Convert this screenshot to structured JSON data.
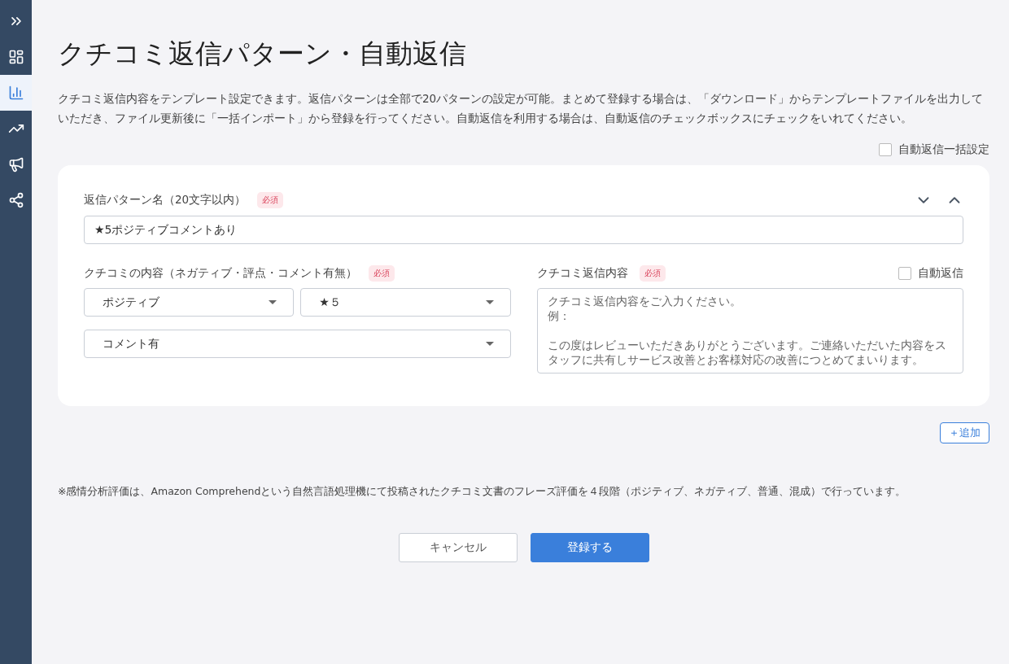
{
  "sidebar": {
    "items": [
      {
        "kind": "expand",
        "selected": false
      },
      {
        "kind": "dashboard",
        "selected": false
      },
      {
        "kind": "chart",
        "selected": true
      },
      {
        "kind": "trend",
        "selected": false
      },
      {
        "kind": "megaphone",
        "selected": false
      },
      {
        "kind": "share",
        "selected": false
      }
    ]
  },
  "title": "クチコミ返信パターン・自動返信",
  "description": "クチコミ返信内容をテンプレート設定できます。返信パターンは全部で20パターンの設定が可能。まとめて登録する場合は、「ダウンロード」からテンプレートファイルを出力していただき、ファイル更新後に「一括インポート」から登録を行ってください。自動返信を利用する場合は、自動返信のチェックボックスにチェックをいれてください。",
  "bulk_auto_reply": {
    "label": "自動返信一括設定",
    "checked": false
  },
  "pattern": {
    "name_label": "返信パターン名（20文字以内）",
    "name_required": "必須",
    "name_value": "★5ポジティブコメントあり",
    "content_label": "クチコミの内容（ネガティブ・評点・コメント有無）",
    "content_required": "必須",
    "selects": [
      "ポジティブ",
      "★５",
      "コメント有"
    ],
    "reply_label": "クチコミ返信内容",
    "reply_required": "必須",
    "auto_reply": {
      "label": "自動返信",
      "checked": false
    },
    "reply_placeholder": [
      "クチコミ返信内容をご入力ください。",
      "例：",
      "この度はレビューいただきありがとうございます。ご連絡いただいた内容をスタッフに共有しサービス改善とお客様対応の改善につとめてまいります。"
    ]
  },
  "add_button": "＋追加",
  "note": "※感情分析評価は、Amazon Comprehendという自然言語処理機にて投稿されたクチコミ文書のフレーズ評価を４段階（ポジティブ、ネガティブ、普通、混成）で行っています。",
  "buttons": {
    "cancel": "キャンセル",
    "submit": "登録する"
  }
}
